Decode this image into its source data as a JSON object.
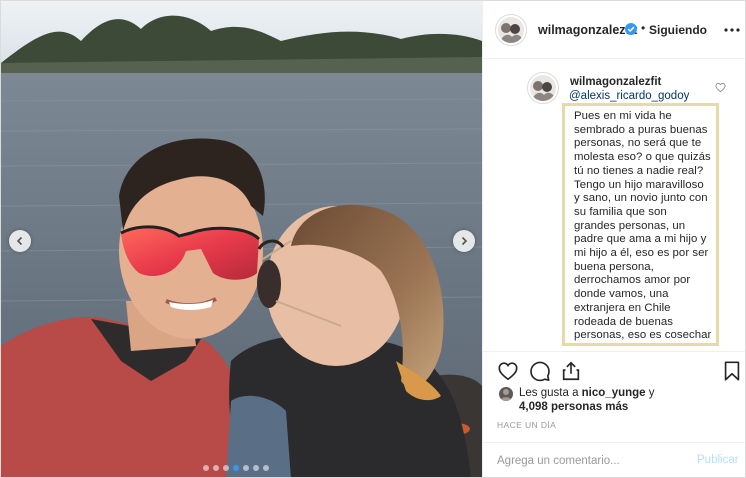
{
  "post": {
    "username": "wilmagonzalezfit",
    "separator": "•",
    "follow_label": "Siguiendo",
    "carousel": {
      "slide_count": 7,
      "active_index": 3
    }
  },
  "comment": {
    "username": "wilmagonzalezfit",
    "mention": "@alexis_ricardo_godoy",
    "text": "Pues en mi vida he\nsembrado a puras buenas\npersonas, no será que te\nmolesta eso? o que quizás\ntú no tienes a nadie real?\nTengo un hijo maravilloso\ny sano, un novio junto con\nsu familia que son\ngrandes personas, un\npadre que ama a mi hijo y\nmi hijo a él, eso es por ser\nbuena persona,\nderrochamos amor por\ndonde vamos, una\nextranjera en Chile\nrodeada de buenas\npersonas, eso es cosechar"
  },
  "likes": {
    "prefix": "Les gusta a ",
    "user": "nico_yunge",
    "suffix": " y",
    "count": "4,098 personas más"
  },
  "timestamp": "HACE UN DÍA",
  "comment_bar": {
    "placeholder": "Agrega un comentario...",
    "publish_label": "Publicar"
  },
  "icons": {
    "verified": "verified-badge-icon",
    "more": "more-options-icon",
    "like": "heart-icon",
    "comment": "comment-bubble-icon",
    "share": "share-icon",
    "save": "bookmark-icon",
    "prev": "chevron-left-icon",
    "next": "chevron-right-icon"
  },
  "colors": {
    "link": "#003569",
    "verified": "#3897f0",
    "publish_disabled": "#b2dffc",
    "highlight_box": "#e6dba6",
    "active_dot": "#3897f0"
  }
}
